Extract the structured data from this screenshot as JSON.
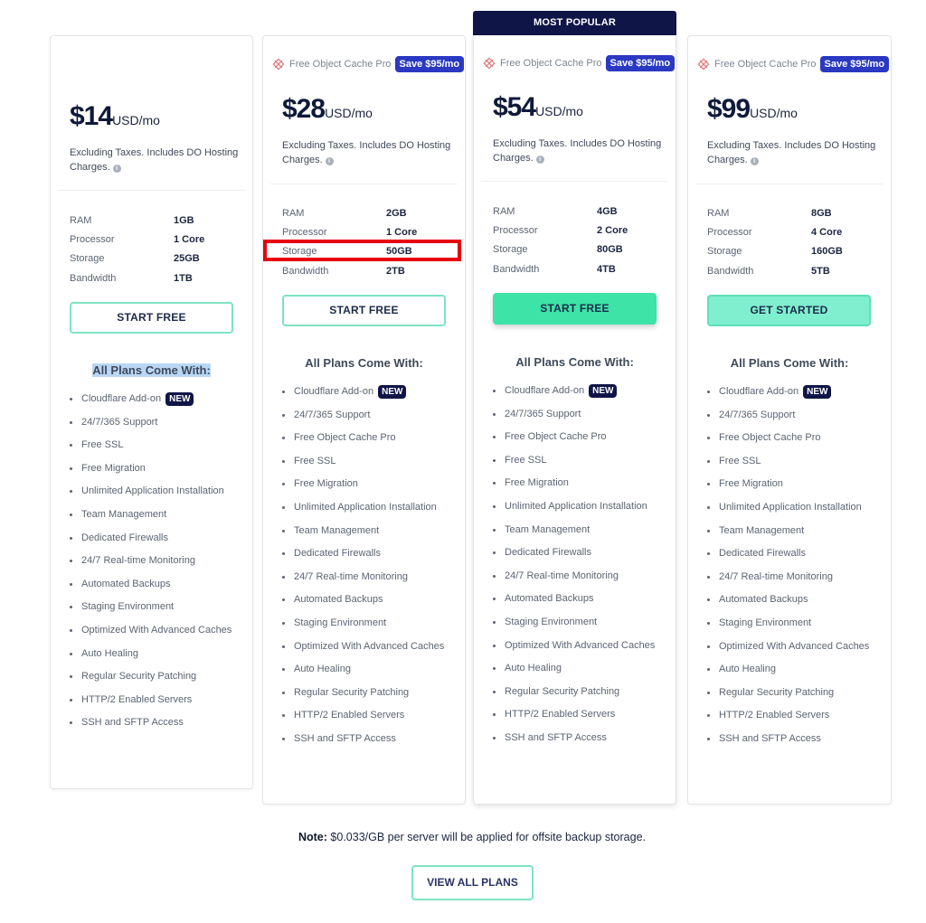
{
  "popular_banner": "MOST POPULAR",
  "features_title": "All Plans Come With:",
  "new_badge": "NEW",
  "info_glyph": "i",
  "plans": [
    {
      "price": "$14",
      "unit": "USD/mo",
      "tax_note": "Excluding Taxes. Includes DO Hosting Charges.",
      "promo": null,
      "specs": [
        {
          "label": "RAM",
          "value": "1GB"
        },
        {
          "label": "Processor",
          "value": "1 Core"
        },
        {
          "label": "Storage",
          "value": "25GB"
        },
        {
          "label": "Bandwidth",
          "value": "1TB"
        }
      ],
      "cta": "START FREE",
      "features": [
        "Cloudflare Add-on",
        "24/7/365 Support",
        "Free SSL",
        "Free Migration",
        "Unlimited Application Installation",
        "Team Management",
        "Dedicated Firewalls",
        "24/7 Real-time Monitoring",
        "Automated Backups",
        "Staging Environment",
        "Optimized With Advanced Caches",
        "Auto Healing",
        "Regular Security Patching",
        "HTTP/2 Enabled Servers",
        "SSH and SFTP Access"
      ]
    },
    {
      "price": "$28",
      "unit": "USD/mo",
      "tax_note": "Excluding Taxes. Includes DO Hosting Charges.",
      "promo": {
        "text": "Free Object Cache Pro",
        "badge": "Save $95/mo"
      },
      "specs": [
        {
          "label": "RAM",
          "value": "2GB"
        },
        {
          "label": "Processor",
          "value": "1 Core"
        },
        {
          "label": "Storage",
          "value": "50GB"
        },
        {
          "label": "Bandwidth",
          "value": "2TB"
        }
      ],
      "cta": "START FREE",
      "features": [
        "Cloudflare Add-on",
        "24/7/365 Support",
        "Free Object Cache Pro",
        "Free SSL",
        "Free Migration",
        "Unlimited Application Installation",
        "Team Management",
        "Dedicated Firewalls",
        "24/7 Real-time Monitoring",
        "Automated Backups",
        "Staging Environment",
        "Optimized With Advanced Caches",
        "Auto Healing",
        "Regular Security Patching",
        "HTTP/2 Enabled Servers",
        "SSH and SFTP Access"
      ]
    },
    {
      "price": "$54",
      "unit": "USD/mo",
      "tax_note": "Excluding Taxes. Includes DO Hosting Charges.",
      "promo": {
        "text": "Free Object Cache Pro",
        "badge": "Save $95/mo"
      },
      "specs": [
        {
          "label": "RAM",
          "value": "4GB"
        },
        {
          "label": "Processor",
          "value": "2 Core"
        },
        {
          "label": "Storage",
          "value": "80GB"
        },
        {
          "label": "Bandwidth",
          "value": "4TB"
        }
      ],
      "cta": "START FREE",
      "features": [
        "Cloudflare Add-on",
        "24/7/365 Support",
        "Free Object Cache Pro",
        "Free SSL",
        "Free Migration",
        "Unlimited Application Installation",
        "Team Management",
        "Dedicated Firewalls",
        "24/7 Real-time Monitoring",
        "Automated Backups",
        "Staging Environment",
        "Optimized With Advanced Caches",
        "Auto Healing",
        "Regular Security Patching",
        "HTTP/2 Enabled Servers",
        "SSH and SFTP Access"
      ]
    },
    {
      "price": "$99",
      "unit": "USD/mo",
      "tax_note": "Excluding Taxes. Includes DO Hosting Charges.",
      "promo": {
        "text": "Free Object Cache Pro",
        "badge": "Save $95/mo"
      },
      "specs": [
        {
          "label": "RAM",
          "value": "8GB"
        },
        {
          "label": "Processor",
          "value": "4 Core"
        },
        {
          "label": "Storage",
          "value": "160GB"
        },
        {
          "label": "Bandwidth",
          "value": "5TB"
        }
      ],
      "cta": "GET STARTED",
      "features": [
        "Cloudflare Add-on",
        "24/7/365 Support",
        "Free Object Cache Pro",
        "Free SSL",
        "Free Migration",
        "Unlimited Application Installation",
        "Team Management",
        "Dedicated Firewalls",
        "24/7 Real-time Monitoring",
        "Automated Backups",
        "Staging Environment",
        "Optimized With Advanced Caches",
        "Auto Healing",
        "Regular Security Patching",
        "HTTP/2 Enabled Servers",
        "SSH and SFTP Access"
      ]
    }
  ],
  "note": {
    "label": "Note:",
    "text": " $0.033/GB per server will be applied for offsite backup storage."
  },
  "view_all": "VIEW ALL PLANS",
  "colors": {
    "navy": "#0f1547",
    "accent_green": "#3de3a7",
    "save_badge": "#2a38c2",
    "highlight_red": "#e8000b"
  }
}
